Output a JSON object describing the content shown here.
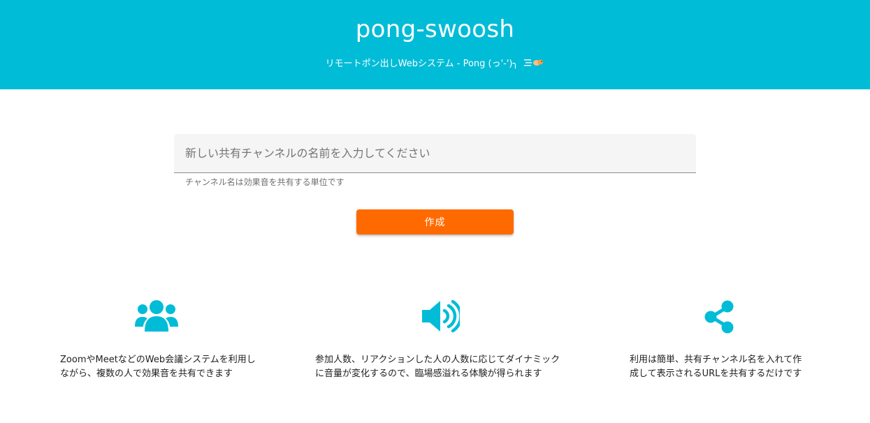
{
  "header": {
    "title": "pong-swoosh",
    "subtitle": "リモートポン出しWebシステム - Pong (っ'-')╮",
    "emoji": "swoosh-emoji"
  },
  "form": {
    "placeholder": "新しい共有チャンネルの名前を入力してください",
    "value": "",
    "helper": "チャンネル名は効果音を共有する単位です",
    "create_label": "作成"
  },
  "features": [
    {
      "icon": "users-icon",
      "line1": "ZoomやMeetなどのWeb会議システムを利用し",
      "line2": "ながら、複数の人で効果音を共有できます"
    },
    {
      "icon": "speaker-icon",
      "line1": "参加人数、リアクションした人の人数に応じてダイナミック",
      "line2": "に音量が変化するので、臨場感溢れる体験が得られます"
    },
    {
      "icon": "share-icon",
      "line1": "利用は簡単、共有チャンネル名を入れて作",
      "line2": "成して表示されるURLを共有するだけです"
    }
  ],
  "colors": {
    "header": "#00bcd7",
    "accent": "#ff6a00",
    "icon": "#00bcd7"
  }
}
